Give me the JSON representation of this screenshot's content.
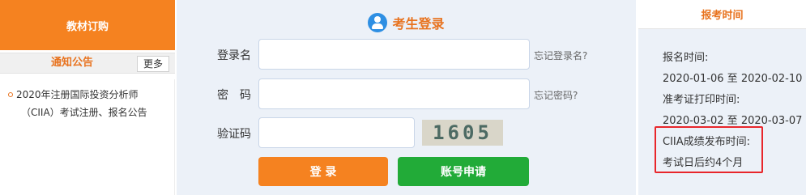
{
  "left": {
    "textbook_label": "教材订购",
    "notice_title": "通知公告",
    "more_label": "更多",
    "notices": [
      {
        "line1": "2020年注册国际投资分析师",
        "line2": "（CIIA）考试注册、报名公告"
      }
    ]
  },
  "login": {
    "title": "考生登录",
    "username_label": "登录名",
    "username_value": "",
    "forgot_username": "忘记登录名?",
    "password_label": "密　码",
    "password_value": "",
    "forgot_password": "忘记密码?",
    "captcha_label": "验证码",
    "captcha_value": "",
    "captcha_text": "1605",
    "login_button": "登 录",
    "apply_button": "账号申请"
  },
  "schedule": {
    "title": "报考时间",
    "lines": [
      "报名时间:",
      "2020-01-06 至 2020-02-10",
      "准考证打印时间:",
      "2020-03-02 至 2020-03-07",
      "CIIA成绩发布时间:",
      "考试日后约4个月"
    ]
  },
  "colors": {
    "accent_orange": "#f58220",
    "accent_green": "#22ab38",
    "highlight_red": "#e8262b",
    "panel_bg": "#ecf1f8"
  },
  "icons": {
    "login_header_icon": "user-icon",
    "notice_bullet": "circle-bullet-icon"
  }
}
